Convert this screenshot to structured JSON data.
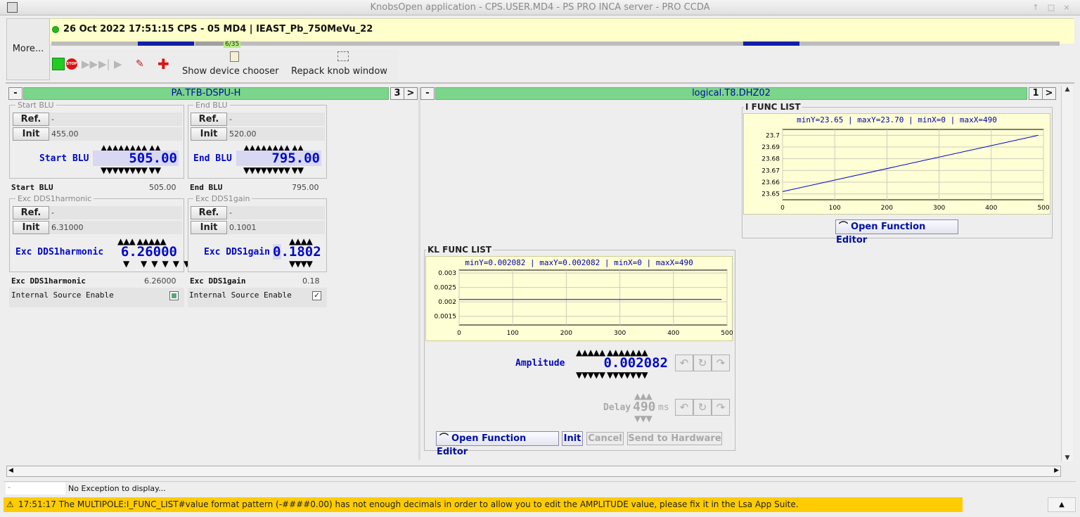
{
  "window": {
    "title": "KnobsOpen application - CPS.USER.MD4 - PS PRO INCA server - PRO CCDA",
    "controls": [
      "↑",
      "□",
      "×"
    ]
  },
  "more_label": "More...",
  "status": {
    "text": "26 Oct 2022  17:51:15  CPS - 05 MD4 | IEAST_Pb_750MeVu_22",
    "counter": "6/35"
  },
  "toolbar": {
    "show_device_chooser": "Show device chooser",
    "repack": "Repack knob window",
    "stop": "STOP"
  },
  "left_panel": {
    "minus": "-",
    "title": "PA.TFB-DSPU-H",
    "count": "3",
    "next": ">",
    "start_blu": {
      "group": "Start BLU",
      "ref": "Ref.",
      "ref_val": "-",
      "init": "Init",
      "init_val": "455.00",
      "label": "Start BLU",
      "value": "505.00",
      "summary_label": "Start BLU",
      "summary_value": "505.00",
      "up": "▲▲▲▲▲▲▲▲ ▲▲",
      "down": "▼▼▼▼▼▼▼▼ ▼▼"
    },
    "end_blu": {
      "group": "End BLU",
      "ref": "Ref.",
      "ref_val": "-",
      "init": "Init",
      "init_val": "520.00",
      "label": "End BLU",
      "value": "795.00",
      "summary_label": "End BLU",
      "summary_value": "795.00",
      "up": "▲▲▲▲▲▲▲▲ ▲▲",
      "down": "▼▼▼▼▼▼▼▼ ▼▼"
    },
    "harm": {
      "group": "Exc DDS1harmonic",
      "ref": "Ref.",
      "ref_val": "-",
      "init": "Init",
      "init_val": "6.31000",
      "label": "Exc DDS1harmonic",
      "value": "6.26000",
      "summary_label": "Exc DDS1harmonic",
      "summary_value": "6.26000",
      "up": "▲▲▲ ▲▲▲▲▲",
      "down": "▼ ▼▼▼▼▼"
    },
    "gain": {
      "group": "Exc DDS1gain",
      "ref": "Ref.",
      "ref_val": "-",
      "init": "Init",
      "init_val": "0.1001",
      "label": "Exc DDS1gain",
      "value": "0.1802",
      "summary_label": "Exc DDS1gain",
      "summary_value": "0.18",
      "up": "▲▲▲▲",
      "down": "▼▼▼▼"
    },
    "ise_label": "Internal Source Enable"
  },
  "right_panel": {
    "minus": "-",
    "title": "logical.T8.DHZ02",
    "count": "1",
    "next": ">",
    "ifunc": {
      "title": "I FUNC LIST",
      "info": "minY=23.65 | maxY=23.70 | minX=0 | maxX=490",
      "yticks": [
        "23.7",
        "23.69",
        "23.68",
        "23.67",
        "23.66",
        "23.65"
      ],
      "xticks": [
        "0",
        "100",
        "200",
        "300",
        "400",
        "500"
      ],
      "open_editor": "Open Function Editor"
    },
    "kl": {
      "title": "KL FUNC LIST",
      "info": "minY=0.002082 | maxY=0.002082 | minX=0 | maxX=490",
      "yticks": [
        "0.003",
        "0.0025",
        "0.002",
        "0.0015"
      ],
      "xticks": [
        "0",
        "100",
        "200",
        "300",
        "400",
        "500"
      ],
      "amp_label": "Amplitude",
      "amp_value": "0.002082",
      "amp_up": "▲▲▲▲▲ ▲▲▲▲▲▲▲",
      "amp_down": "▼▼▼▼▼ ▼▼▼▼▼▼▼",
      "delay_label": "Delay",
      "delay_value": "490",
      "delay_unit": "ms",
      "delay_up": "▲▲▲",
      "delay_down": "▼▼▼",
      "open_editor": "Open Function Editor",
      "init": "Init",
      "cancel": "Cancel",
      "send": "Send to Hardware"
    }
  },
  "chart_data": [
    {
      "type": "line",
      "title": "I FUNC LIST",
      "x": [
        0,
        490
      ],
      "series": [
        {
          "values": [
            23.652,
            23.7
          ]
        }
      ],
      "xlim": [
        0,
        500
      ],
      "ylim": [
        23.645,
        23.705
      ],
      "grid": true
    },
    {
      "type": "line",
      "title": "KL FUNC LIST",
      "x": [
        0,
        490
      ],
      "series": [
        {
          "values": [
            0.002082,
            0.002082
          ]
        }
      ],
      "xlim": [
        0,
        500
      ],
      "ylim": [
        0.0012,
        0.0031
      ],
      "grid": true
    }
  ],
  "exception": {
    "left": "-",
    "text": "No Exception to display..."
  },
  "warning": {
    "icon": "⚠",
    "text": "17:51:17 The MULTIPOLE:I_FUNC_LIST#value format pattern (-####0.00) has not enough decimals in order to allow you to edit the AMPLITUDE value, please fix it in the Lsa App Suite."
  },
  "colors": {
    "accent_header": "#7bd58b",
    "value_blue": "#0008c8",
    "warning": "#ffcc00",
    "status_bg": "#ffffcc"
  }
}
